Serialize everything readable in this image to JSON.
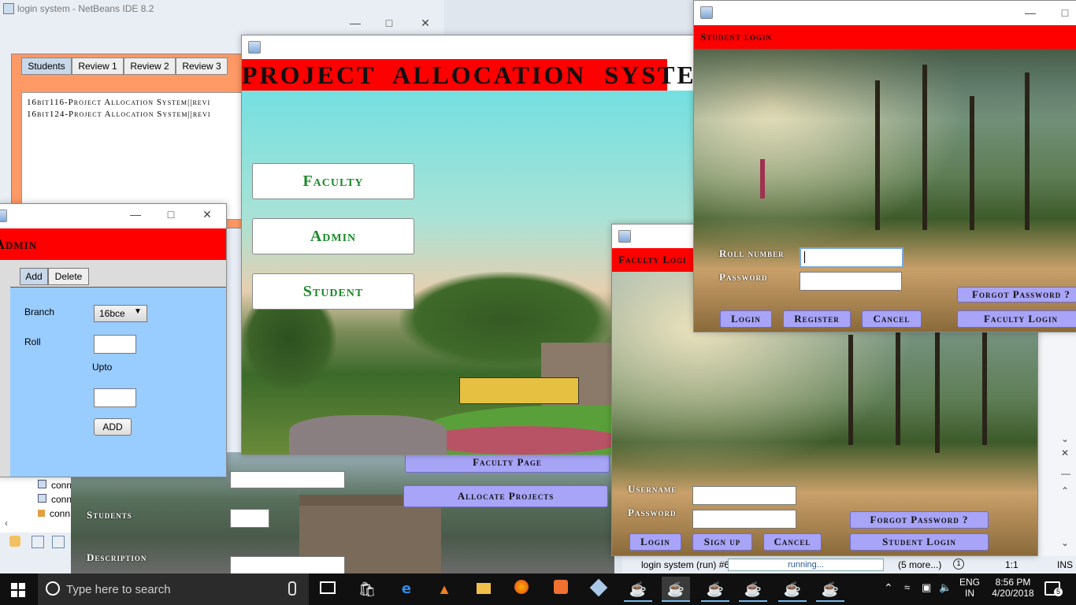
{
  "netbeans": {
    "title": "login system - NetBeans IDE 8.2",
    "status_run": "login system (run) #6",
    "status_running": "running...",
    "status_more": "(5 more...)",
    "status_pos": "1:1",
    "status_mode": "INS",
    "tree_items": [
      "conn",
      "conn",
      "conn"
    ]
  },
  "review_window": {
    "tabs": [
      "Students",
      "Review 1",
      "Review 2",
      "Review 3"
    ],
    "lines": [
      "16bit116-Project Allocation System||revi",
      "16bit124-Project Allocation System||revi"
    ]
  },
  "admin_window": {
    "header": "Admin",
    "tabs": [
      "Add",
      "Delete"
    ],
    "branch_label": "Branch",
    "branch_value": "16bce",
    "roll_label": "Roll",
    "upto_label": "Upto",
    "add_button": "ADD"
  },
  "main_window": {
    "header": "PROJECT ALLOCATION SYSTEM",
    "buttons": [
      "Faculty",
      "Admin",
      "Student"
    ]
  },
  "faculty_page": {
    "faculty_page_button": "Faculty Page",
    "allocate_button": "Allocate Projects",
    "students_label": "Students",
    "description_label": "Description"
  },
  "faculty_login": {
    "header": "Faculty Logi",
    "username_label": "Username",
    "password_label": "Password",
    "forgot_button": "Forgot Password ?",
    "login_button": "Login",
    "signup_button": "Sign up",
    "cancel_button": "Cancel",
    "student_login_button": "Student Login"
  },
  "student_login": {
    "header": "Student login",
    "roll_label": "Roll number",
    "password_label": "Password",
    "forgot_button": "Forgot Password ?",
    "login_button": "Login",
    "register_button": "Register",
    "cancel_button": "Cancel",
    "faculty_login_button": "Faculty Login"
  },
  "taskbar": {
    "search_placeholder": "Type here to search",
    "lang1": "ENG",
    "lang2": "IN",
    "time": "8:56 PM",
    "date": "4/20/2018",
    "notif_count": "5"
  },
  "colors": {
    "header_red": "#ff0000",
    "button_lavender": "#a8a4f8",
    "admin_panel_blue": "#99ccff",
    "salmon": "#ff9966",
    "green_text": "#1a8a2a"
  }
}
